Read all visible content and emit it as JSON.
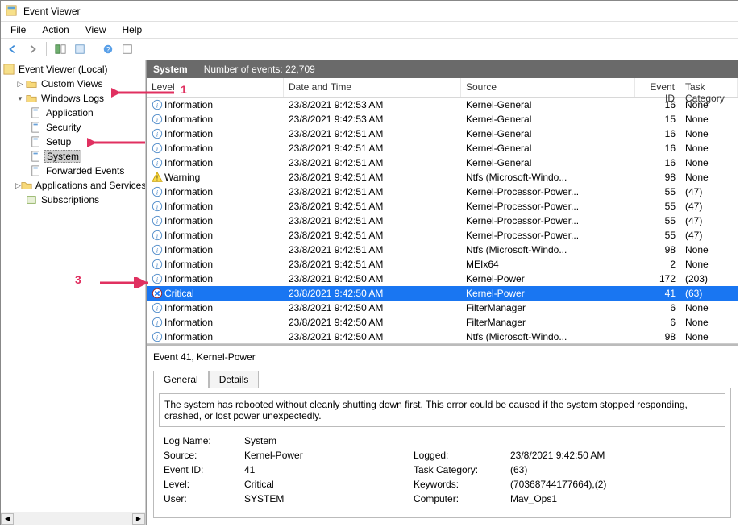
{
  "window": {
    "title": "Event Viewer"
  },
  "menu": {
    "file": "File",
    "action": "Action",
    "view": "View",
    "help": "Help"
  },
  "tree": {
    "root": "Event Viewer (Local)",
    "custom": "Custom Views",
    "winlogs": "Windows Logs",
    "app": "Application",
    "sec": "Security",
    "setup": "Setup",
    "system": "System",
    "fwd": "Forwarded Events",
    "svc": "Applications and Services Lo",
    "subs": "Subscriptions"
  },
  "header": {
    "title": "System",
    "count_label": "Number of events: 22,709"
  },
  "cols": {
    "level": "Level",
    "date": "Date and Time",
    "source": "Source",
    "eid": "Event ID",
    "cat": "Task Category"
  },
  "rows": [
    {
      "lvl": "Information",
      "date": "23/8/2021 9:42:53 AM",
      "src": "Kernel-General",
      "eid": "16",
      "cat": "None",
      "icon": "info"
    },
    {
      "lvl": "Information",
      "date": "23/8/2021 9:42:53 AM",
      "src": "Kernel-General",
      "eid": "15",
      "cat": "None",
      "icon": "info"
    },
    {
      "lvl": "Information",
      "date": "23/8/2021 9:42:51 AM",
      "src": "Kernel-General",
      "eid": "16",
      "cat": "None",
      "icon": "info"
    },
    {
      "lvl": "Information",
      "date": "23/8/2021 9:42:51 AM",
      "src": "Kernel-General",
      "eid": "16",
      "cat": "None",
      "icon": "info"
    },
    {
      "lvl": "Information",
      "date": "23/8/2021 9:42:51 AM",
      "src": "Kernel-General",
      "eid": "16",
      "cat": "None",
      "icon": "info"
    },
    {
      "lvl": "Warning",
      "date": "23/8/2021 9:42:51 AM",
      "src": "Ntfs (Microsoft-Windo...",
      "eid": "98",
      "cat": "None",
      "icon": "warn"
    },
    {
      "lvl": "Information",
      "date": "23/8/2021 9:42:51 AM",
      "src": "Kernel-Processor-Power...",
      "eid": "55",
      "cat": "(47)",
      "icon": "info"
    },
    {
      "lvl": "Information",
      "date": "23/8/2021 9:42:51 AM",
      "src": "Kernel-Processor-Power...",
      "eid": "55",
      "cat": "(47)",
      "icon": "info"
    },
    {
      "lvl": "Information",
      "date": "23/8/2021 9:42:51 AM",
      "src": "Kernel-Processor-Power...",
      "eid": "55",
      "cat": "(47)",
      "icon": "info"
    },
    {
      "lvl": "Information",
      "date": "23/8/2021 9:42:51 AM",
      "src": "Kernel-Processor-Power...",
      "eid": "55",
      "cat": "(47)",
      "icon": "info"
    },
    {
      "lvl": "Information",
      "date": "23/8/2021 9:42:51 AM",
      "src": "Ntfs (Microsoft-Windo...",
      "eid": "98",
      "cat": "None",
      "icon": "info"
    },
    {
      "lvl": "Information",
      "date": "23/8/2021 9:42:51 AM",
      "src": "MEIx64",
      "eid": "2",
      "cat": "None",
      "icon": "info"
    },
    {
      "lvl": "Information",
      "date": "23/8/2021 9:42:50 AM",
      "src": "Kernel-Power",
      "eid": "172",
      "cat": "(203)",
      "icon": "info"
    },
    {
      "lvl": "Critical",
      "date": "23/8/2021 9:42:50 AM",
      "src": "Kernel-Power",
      "eid": "41",
      "cat": "(63)",
      "icon": "crit",
      "selected": true
    },
    {
      "lvl": "Information",
      "date": "23/8/2021 9:42:50 AM",
      "src": "FilterManager",
      "eid": "6",
      "cat": "None",
      "icon": "info"
    },
    {
      "lvl": "Information",
      "date": "23/8/2021 9:42:50 AM",
      "src": "FilterManager",
      "eid": "6",
      "cat": "None",
      "icon": "info"
    },
    {
      "lvl": "Information",
      "date": "23/8/2021 9:42:50 AM",
      "src": "Ntfs (Microsoft-Windo...",
      "eid": "98",
      "cat": "None",
      "icon": "info"
    }
  ],
  "detail": {
    "title": "Event 41, Kernel-Power",
    "tab_general": "General",
    "tab_details": "Details",
    "message": "The system has rebooted without cleanly shutting down first. This error could be caused if the system stopped responding, crashed, or lost power unexpectedly.",
    "p": {
      "logname_l": "Log Name:",
      "logname_v": "System",
      "source_l": "Source:",
      "source_v": "Kernel-Power",
      "logged_l": "Logged:",
      "logged_v": "23/8/2021 9:42:50 AM",
      "eid_l": "Event ID:",
      "eid_v": "41",
      "cat_l": "Task Category:",
      "cat_v": "(63)",
      "level_l": "Level:",
      "level_v": "Critical",
      "kw_l": "Keywords:",
      "kw_v": "(70368744177664),(2)",
      "user_l": "User:",
      "user_v": "SYSTEM",
      "comp_l": "Computer:",
      "comp_v": "Mav_Ops1"
    }
  },
  "annot": {
    "one": "1",
    "three": "3"
  }
}
